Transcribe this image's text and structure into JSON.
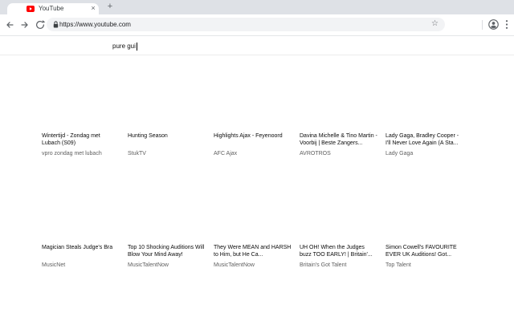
{
  "browser": {
    "tab": {
      "title": "YouTube"
    },
    "controls": {
      "close": "×",
      "new_tab": "+",
      "bookmark_star": "☆"
    },
    "address_bar": {
      "url": "https://www.youtube.com"
    }
  },
  "page": {
    "search": {
      "value": "pure gui"
    },
    "videos": [
      {
        "title": "Wintertijd - Zondag met Lubach (S09)",
        "channel": "vpro zondag met lubach"
      },
      {
        "title": "Hunting Season",
        "channel": "StukTV"
      },
      {
        "title": "Highlights Ajax - Feyenoord",
        "channel": "AFC Ajax"
      },
      {
        "title": "Davina Michelle & Tino Martin - Voorbij | Beste Zangers...",
        "channel": "AVROTROS"
      },
      {
        "title": "Lady Gaga, Bradley Cooper - I'll Never Love Again (A Sta...",
        "channel": "Lady Gaga"
      },
      {
        "title": "Magician Steals Judge's Bra",
        "channel": "MusicNet"
      },
      {
        "title": "Top 10 Shocking Auditions Will Blow Your Mind Away!",
        "channel": "MusicTalentNow"
      },
      {
        "title": "They Were MEAN and HARSH to Him, but He Ca...",
        "channel": "MusicTalentNow"
      },
      {
        "title": "UH OH! When the Judges buzz TOO EARLY! | Britain'...",
        "channel": "Britain's Got Talent"
      },
      {
        "title": "Simon Cowell's FAVOURITE EVER UK Auditions! Got...",
        "channel": "Top Talent"
      }
    ]
  },
  "colors": {
    "brand_red": "#FF0000",
    "tab_strip_bg": "#DEE1E6",
    "omnibox_bg": "#F2F3F5",
    "icon_gray": "#5F6368",
    "title_text": "#0B0B0B",
    "channel_text": "#606060"
  }
}
